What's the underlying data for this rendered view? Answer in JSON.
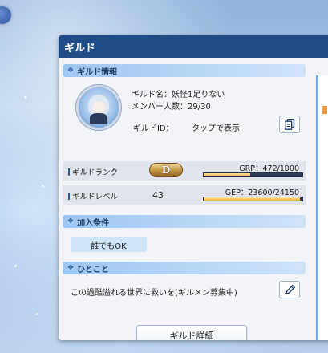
{
  "panel": {
    "title": "ギルド"
  },
  "guild_info": {
    "header": "ギルド情報",
    "name_label": "ギルド名：",
    "name": "妖怪1足りない",
    "members_label": "メンバー人数：",
    "members": "29/30",
    "id_label": "ギルドID：",
    "id_value": "タップで表示"
  },
  "rank": {
    "label": "ギルドランク",
    "grade": "D",
    "value_text": "GRP：472/1000",
    "progress": 0.472
  },
  "level": {
    "label": "ギルドレベル",
    "level": "43",
    "value_text": "GEP：23600/24150",
    "progress": 0.977
  },
  "join": {
    "header": "加入条件",
    "condition": "誰でもOK"
  },
  "message": {
    "header": "ひとこと",
    "text": "この過酷溢れる世界に救いを(ギルメン募集中)"
  },
  "buttons": {
    "detail": "ギルド詳細"
  },
  "icons": {
    "copy": "copy-icon",
    "edit": "pencil-icon"
  },
  "colors": {
    "title_bar": "#1f4c87",
    "accent": "#6fa8e8",
    "progress_fill": "#e9b23a"
  }
}
